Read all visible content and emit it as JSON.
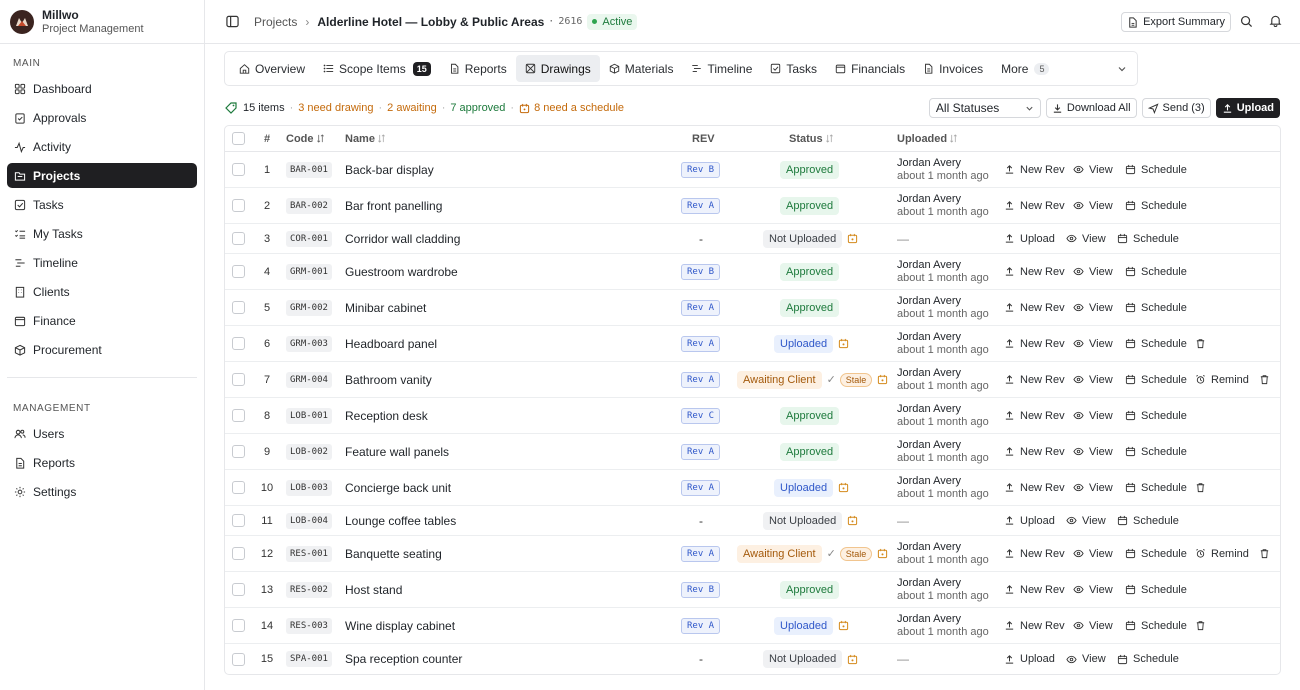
{
  "app": {
    "name": "Millwo",
    "subtitle": "Project Management"
  },
  "sidebar": {
    "main_label": "MAIN",
    "main_items": [
      {
        "label": "Dashboard",
        "icon": "dashboard-icon"
      },
      {
        "label": "Approvals",
        "icon": "clipboard-check-icon"
      },
      {
        "label": "Activity",
        "icon": "activity-icon"
      },
      {
        "label": "Projects",
        "icon": "folder-icon",
        "active": true
      },
      {
        "label": "Tasks",
        "icon": "check-square-icon"
      },
      {
        "label": "My Tasks",
        "icon": "list-check-icon"
      },
      {
        "label": "Timeline",
        "icon": "timeline-icon"
      },
      {
        "label": "Clients",
        "icon": "building-icon"
      },
      {
        "label": "Finance",
        "icon": "wallet-icon"
      },
      {
        "label": "Procurement",
        "icon": "box-icon"
      }
    ],
    "management_label": "MANAGEMENT",
    "management_items": [
      {
        "label": "Users",
        "icon": "users-icon"
      },
      {
        "label": "Reports",
        "icon": "file-icon"
      },
      {
        "label": "Settings",
        "icon": "gear-icon"
      }
    ]
  },
  "header": {
    "crumb_root": "Projects",
    "project_title": "Alderline Hotel — Lobby & Public Areas",
    "project_sep": "·",
    "project_number": "2616",
    "status": "Active",
    "export_label": "Export Summary"
  },
  "tabs": [
    {
      "label": "Overview",
      "icon": "home-icon"
    },
    {
      "label": "Scope Items",
      "icon": "list-icon",
      "count": "15"
    },
    {
      "label": "Reports",
      "icon": "file-icon"
    },
    {
      "label": "Drawings",
      "icon": "drawing-icon",
      "active": true
    },
    {
      "label": "Materials",
      "icon": "box-icon"
    },
    {
      "label": "Timeline",
      "icon": "timeline-icon"
    },
    {
      "label": "Tasks",
      "icon": "check-square-icon"
    },
    {
      "label": "Financials",
      "icon": "wallet-icon"
    },
    {
      "label": "Invoices",
      "icon": "file-icon"
    },
    {
      "label": "More",
      "count": "5"
    }
  ],
  "summary": {
    "items": "15 items",
    "sep": "·",
    "need_drawing": "3 need drawing",
    "awaiting": "2 awaiting",
    "approved": "7 approved",
    "need_schedule": "8 need a schedule"
  },
  "filters": {
    "status_select": "All Statuses",
    "download_all": "Download All",
    "send": "Send (3)",
    "upload": "Upload"
  },
  "columns": {
    "num": "#",
    "code": "Code",
    "name": "Name",
    "rev": "REV",
    "status": "Status",
    "uploaded": "Uploaded"
  },
  "colors": {
    "accent": "#1f1f22",
    "approved": "#1d7a3c",
    "orange": "#c46a0b",
    "blue": "#2f57c9"
  },
  "rows": [
    {
      "n": "1",
      "code": "BAR-001",
      "name": "Back-bar display",
      "rev": "Rev B",
      "status": "Approved",
      "by": "Jordan Avery",
      "when": "about 1 month ago",
      "primary": "New Rev",
      "view": "View",
      "schedule": "Schedule"
    },
    {
      "n": "2",
      "code": "BAR-002",
      "name": "Bar front panelling",
      "rev": "Rev A",
      "status": "Approved",
      "by": "Jordan Avery",
      "when": "about 1 month ago",
      "primary": "New Rev",
      "view": "View",
      "schedule": "Schedule"
    },
    {
      "n": "3",
      "code": "COR-001",
      "name": "Corridor wall cladding",
      "rev": "-",
      "status": "Not Uploaded",
      "by": "—",
      "when": "",
      "primary": "Upload",
      "view": "View",
      "schedule": "Schedule",
      "sched_flag": true
    },
    {
      "n": "4",
      "code": "GRM-001",
      "name": "Guestroom wardrobe",
      "rev": "Rev B",
      "status": "Approved",
      "by": "Jordan Avery",
      "when": "about 1 month ago",
      "primary": "New Rev",
      "view": "View",
      "schedule": "Schedule"
    },
    {
      "n": "5",
      "code": "GRM-002",
      "name": "Minibar cabinet",
      "rev": "Rev A",
      "status": "Approved",
      "by": "Jordan Avery",
      "when": "about 1 month ago",
      "primary": "New Rev",
      "view": "View",
      "schedule": "Schedule"
    },
    {
      "n": "6",
      "code": "GRM-003",
      "name": "Headboard panel",
      "rev": "Rev A",
      "status": "Uploaded",
      "by": "Jordan Avery",
      "when": "about 1 month ago",
      "primary": "New Rev",
      "view": "View",
      "schedule": "Schedule",
      "sched_flag": true,
      "trash": true
    },
    {
      "n": "7",
      "code": "GRM-004",
      "name": "Bathroom vanity",
      "rev": "Rev A",
      "status": "Awaiting Client",
      "stale": "Stale",
      "by": "Jordan Avery",
      "when": "about 1 month ago",
      "primary": "New Rev",
      "view": "View",
      "schedule": "Schedule",
      "sched_flag": true,
      "remind": "Remind",
      "trash": true
    },
    {
      "n": "8",
      "code": "LOB-001",
      "name": "Reception desk",
      "rev": "Rev C",
      "status": "Approved",
      "by": "Jordan Avery",
      "when": "about 1 month ago",
      "primary": "New Rev",
      "view": "View",
      "schedule": "Schedule"
    },
    {
      "n": "9",
      "code": "LOB-002",
      "name": "Feature wall panels",
      "rev": "Rev A",
      "status": "Approved",
      "by": "Jordan Avery",
      "when": "about 1 month ago",
      "primary": "New Rev",
      "view": "View",
      "schedule": "Schedule"
    },
    {
      "n": "10",
      "code": "LOB-003",
      "name": "Concierge back unit",
      "rev": "Rev A",
      "status": "Uploaded",
      "by": "Jordan Avery",
      "when": "about 1 month ago",
      "primary": "New Rev",
      "view": "View",
      "schedule": "Schedule",
      "sched_flag": true,
      "trash": true
    },
    {
      "n": "11",
      "code": "LOB-004",
      "name": "Lounge coffee tables",
      "rev": "-",
      "status": "Not Uploaded",
      "by": "—",
      "when": "",
      "primary": "Upload",
      "view": "View",
      "schedule": "Schedule",
      "sched_flag": true
    },
    {
      "n": "12",
      "code": "RES-001",
      "name": "Banquette seating",
      "rev": "Rev A",
      "status": "Awaiting Client",
      "stale": "Stale",
      "by": "Jordan Avery",
      "when": "about 1 month ago",
      "primary": "New Rev",
      "view": "View",
      "schedule": "Schedule",
      "sched_flag": true,
      "remind": "Remind",
      "trash": true
    },
    {
      "n": "13",
      "code": "RES-002",
      "name": "Host stand",
      "rev": "Rev B",
      "status": "Approved",
      "by": "Jordan Avery",
      "when": "about 1 month ago",
      "primary": "New Rev",
      "view": "View",
      "schedule": "Schedule"
    },
    {
      "n": "14",
      "code": "RES-003",
      "name": "Wine display cabinet",
      "rev": "Rev A",
      "status": "Uploaded",
      "by": "Jordan Avery",
      "when": "about 1 month ago",
      "primary": "New Rev",
      "view": "View",
      "schedule": "Schedule",
      "sched_flag": true,
      "trash": true
    },
    {
      "n": "15",
      "code": "SPA-001",
      "name": "Spa reception counter",
      "rev": "-",
      "status": "Not Uploaded",
      "by": "—",
      "when": "",
      "primary": "Upload",
      "view": "View",
      "schedule": "Schedule",
      "sched_flag": true
    }
  ]
}
